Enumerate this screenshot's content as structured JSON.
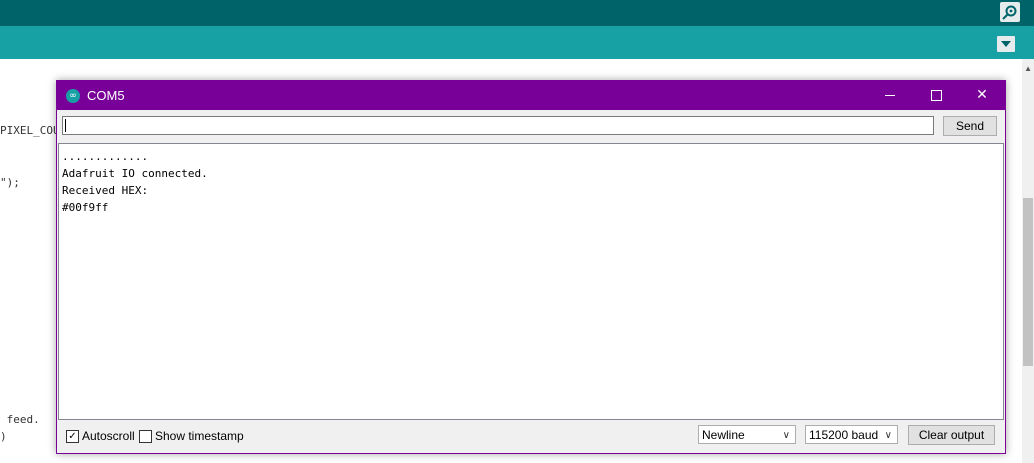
{
  "ide": {
    "code_fragments": [
      {
        "text": "PIXEL_COU"
      },
      {
        "text": "\");"
      },
      {
        "text": " feed."
      },
      {
        "text": ")"
      }
    ],
    "scroll_up_glyph": "▲"
  },
  "serial_monitor": {
    "title": "COM5",
    "app_icon_glyph": "∞",
    "controls": {
      "minimize": "",
      "maximize": "",
      "close": "✕"
    },
    "input": {
      "value": "",
      "placeholder": ""
    },
    "send_label": "Send",
    "output_lines": [
      ".............",
      "Adafruit IO connected.",
      "Received HEX:",
      "#00f9ff"
    ],
    "autoscroll": {
      "label": "Autoscroll",
      "checked": true,
      "glyph": "✓"
    },
    "show_timestamp": {
      "label": "Show timestamp",
      "checked": false
    },
    "line_ending": {
      "selected": "Newline"
    },
    "baud_rate": {
      "selected": "115200 baud"
    },
    "clear_label": "Clear output",
    "chevron_glyph": "∨"
  },
  "colors": {
    "title_bar": "#780098",
    "ide_toolbar": "#00636a",
    "ide_tabbar": "#17a1a5"
  }
}
